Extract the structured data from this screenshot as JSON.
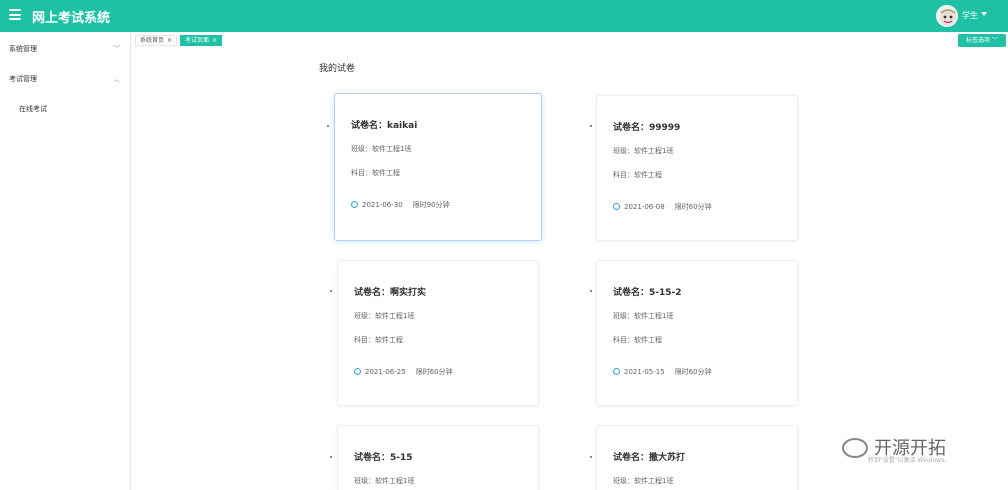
{
  "header": {
    "title": "网上考试系统",
    "user": "学生"
  },
  "sidebar": {
    "groups": [
      {
        "label": "系统管理"
      },
      {
        "label": "考试管理"
      }
    ],
    "items": [
      {
        "label": "在线考试"
      }
    ]
  },
  "tabs": [
    {
      "label": "系统首页",
      "close": "×"
    },
    {
      "label": "考试页面",
      "close": "×"
    }
  ],
  "tag_options": "标签选项",
  "main": {
    "title": "我的试卷",
    "exams": [
      {
        "name": "试卷名：kaikai",
        "class": "班级：软件工程1班",
        "subject": "科目：软件工程",
        "date": "2021-06-30",
        "limit": "限时90分钟"
      },
      {
        "name": "试卷名：99999",
        "class": "班级：软件工程1班",
        "subject": "科目：软件工程",
        "date": "2021-06-08",
        "limit": "限时60分钟"
      },
      {
        "name": "试卷名：啊实打实",
        "class": "班级：软件工程1班",
        "subject": "科目：软件工程",
        "date": "2021-06-25",
        "limit": "限时60分钟"
      },
      {
        "name": "试卷名：5-15-2",
        "class": "班级：软件工程1班",
        "subject": "科目：软件工程",
        "date": "2021-05-15",
        "limit": "限时60分钟"
      },
      {
        "name": "试卷名：5-15",
        "class": "班级：软件工程1班",
        "subject": "",
        "date": "",
        "limit": ""
      },
      {
        "name": "试卷名：撒大苏打",
        "class": "班级：软件工程1班",
        "subject": "",
        "date": "",
        "limit": ""
      }
    ]
  },
  "watermark": {
    "brand": "开源开拓",
    "activate": "转到\"设置\"以激活 Windows。"
  }
}
